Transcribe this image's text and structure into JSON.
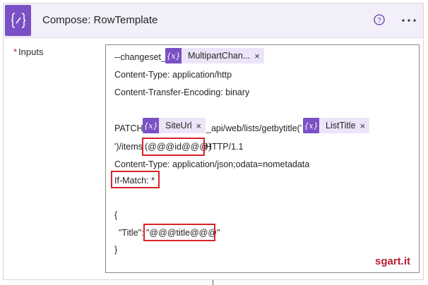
{
  "header": {
    "title": "Compose: RowTemplate",
    "action_icon": "curly-braces-icon",
    "help_icon": "help-circle-icon",
    "more_icon": "more-dots-icon"
  },
  "field": {
    "required_mark": "*",
    "label": "Inputs"
  },
  "editor": {
    "l1_prefix": "--changeset_",
    "token_multipart": "MultipartChan...",
    "l2": "Content-Type: application/http",
    "l3": "Content-Transfer-Encoding: binary",
    "l4_prefix": "PATCH",
    "token_siteurl": "SiteUrl",
    "l4_middle": "_api/web/lists/getbytitle('",
    "token_listtitle": "ListTitle",
    "l5_prefix": "')/items",
    "l5_id": "(@@@id@@@)",
    "l5_suffix": "HTTP/1.1",
    "l6": "Content-Type: application/json;odata=nometadata",
    "l7": "If-Match: *",
    "l8": "{",
    "l9_key": "\"Title\":",
    "l9_value": "\"@@@title@@@\"",
    "l10": "}",
    "token_icon_text": "{x}",
    "token_close": "×"
  },
  "brand": {
    "text": "sgart.it"
  },
  "colors": {
    "accent": "#7a50c5",
    "highlight": "#d8232a",
    "brand": "#b41e32",
    "token_bg": "#ece4f8"
  }
}
